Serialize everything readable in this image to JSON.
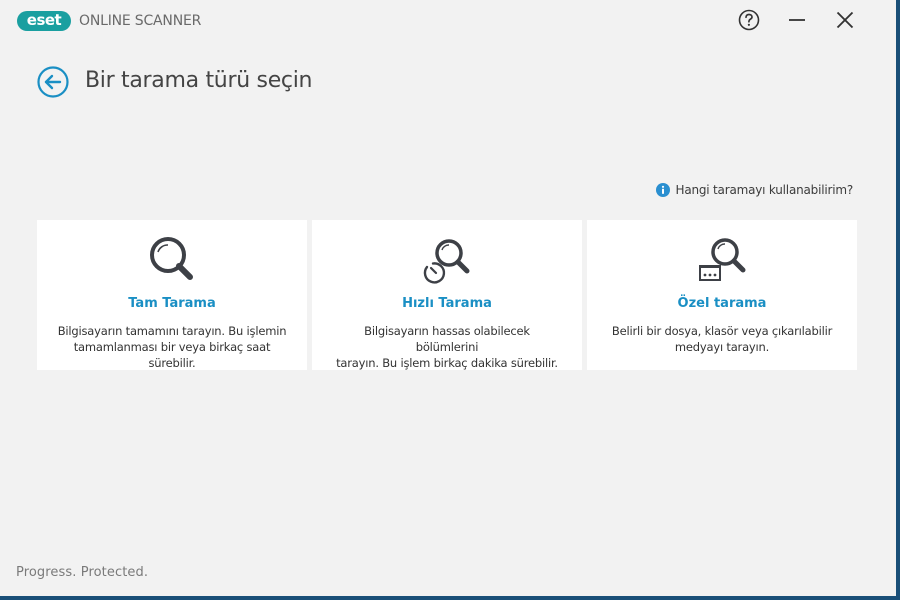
{
  "app": {
    "brand": "eset",
    "title": "ONLINE SCANNER",
    "accent_color": "#1a8fc4",
    "logo_color": "#1a9fa0"
  },
  "window_controls": {
    "help_icon": "question-circle-icon",
    "minimize_icon": "minimize-icon",
    "close_icon": "close-icon"
  },
  "page": {
    "back_icon": "arrow-left-circle-icon",
    "title": "Bir tarama türü seçin"
  },
  "help_link": {
    "icon": "info-icon",
    "label": "Hangi taramayı kullanabilirim?"
  },
  "scan_options": [
    {
      "icon": "magnifier-icon",
      "title": "Tam Tarama",
      "line1": "Bilgisayarın tamamını tarayın. Bu işlemin",
      "line2": "tamamlanması bir veya birkaç saat sürebilir."
    },
    {
      "icon": "magnifier-clock-icon",
      "title": "Hızlı Tarama",
      "line1": "Bilgisayarın hassas olabilecek bölümlerini",
      "line2": "tarayın. Bu işlem birkaç dakika sürebilir."
    },
    {
      "icon": "magnifier-drive-icon",
      "title": "Özel tarama",
      "line1": "Belirli bir dosya, klasör veya çıkarılabilir",
      "line2": "medyayı tarayın."
    }
  ],
  "footer": {
    "tagline": "Progress. Protected."
  }
}
